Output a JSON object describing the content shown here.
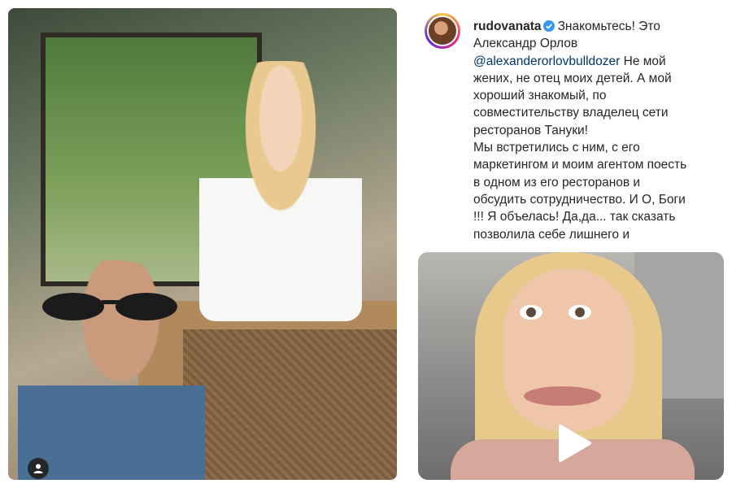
{
  "post": {
    "username": "rudovanata",
    "caption": {
      "line1": "Знакомьтесь! Это",
      "line2": "Александр Орлов",
      "mention": "@alexanderorlovbulldozer",
      "line3_rest": " Не мой",
      "line4": "жених, не отец моих детей. А мой",
      "line5": "хороший знакомый, по",
      "line6": "совместительству владелец сети",
      "line7": "ресторанов Тануки!",
      "line8": "Мы встретились с ним, с его",
      "line9": "маркетингом и моим агентом поесть",
      "line10": "в одном из его ресторанов и",
      "line11": "обсудить сотрудничество. И О, Боги",
      "line12": "!!! Я объелась! Да,да... так сказать",
      "line13": "позволила себе лишнего и"
    }
  },
  "icons": {
    "verified": "verified-badge-icon",
    "profile": "user-profile-icon",
    "play": "play-icon"
  },
  "colors": {
    "verified_blue": "#3897f0",
    "mention": "#00376b",
    "text": "#262626"
  }
}
